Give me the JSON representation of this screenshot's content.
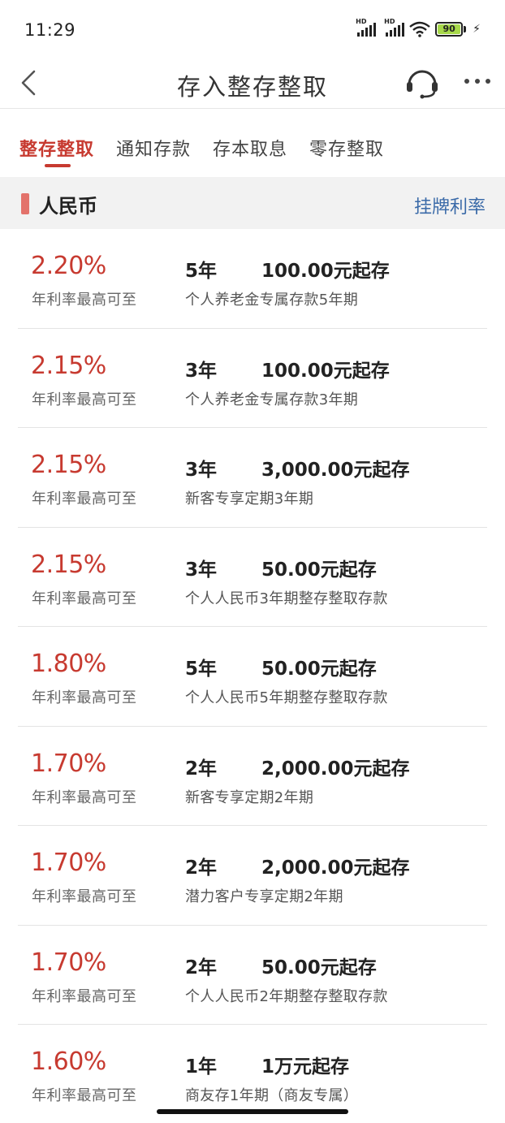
{
  "status_bar": {
    "time": "11:29",
    "battery": "90",
    "signal_label_1": "HD",
    "signal_label_2": "HD"
  },
  "nav": {
    "title": "存入整存整取",
    "icons": [
      "back-chevron-icon",
      "headset-icon",
      "more-icon"
    ]
  },
  "tabs": [
    {
      "label": "整存整取",
      "active": true
    },
    {
      "label": "通知存款",
      "active": false
    },
    {
      "label": "存本取息",
      "active": false
    },
    {
      "label": "零存整取",
      "active": false
    }
  ],
  "section": {
    "title": "人民币",
    "link": "挂牌利率",
    "accent_color": "#e3726b"
  },
  "colors": {
    "accent_red": "#c73a30",
    "link_blue": "#3a6aa8"
  },
  "products": [
    {
      "rate": "2.20%",
      "rate_label": "年利率最高可至",
      "term": "5年",
      "min_amount": "100.00元起存",
      "name": "个人养老金专属存款5年期"
    },
    {
      "rate": "2.15%",
      "rate_label": "年利率最高可至",
      "term": "3年",
      "min_amount": "100.00元起存",
      "name": "个人养老金专属存款3年期"
    },
    {
      "rate": "2.15%",
      "rate_label": "年利率最高可至",
      "term": "3年",
      "min_amount": "3,000.00元起存",
      "name": "新客专享定期3年期"
    },
    {
      "rate": "2.15%",
      "rate_label": "年利率最高可至",
      "term": "3年",
      "min_amount": "50.00元起存",
      "name": "个人人民币3年期整存整取存款"
    },
    {
      "rate": "1.80%",
      "rate_label": "年利率最高可至",
      "term": "5年",
      "min_amount": "50.00元起存",
      "name": "个人人民币5年期整存整取存款"
    },
    {
      "rate": "1.70%",
      "rate_label": "年利率最高可至",
      "term": "2年",
      "min_amount": "2,000.00元起存",
      "name": "新客专享定期2年期"
    },
    {
      "rate": "1.70%",
      "rate_label": "年利率最高可至",
      "term": "2年",
      "min_amount": "2,000.00元起存",
      "name": "潜力客户专享定期2年期"
    },
    {
      "rate": "1.70%",
      "rate_label": "年利率最高可至",
      "term": "2年",
      "min_amount": "50.00元起存",
      "name": "个人人民币2年期整存整取存款"
    },
    {
      "rate": "1.60%",
      "rate_label": "年利率最高可至",
      "term": "1年",
      "min_amount": "1万元起存",
      "name": "商友存1年期（商友专属）"
    }
  ]
}
